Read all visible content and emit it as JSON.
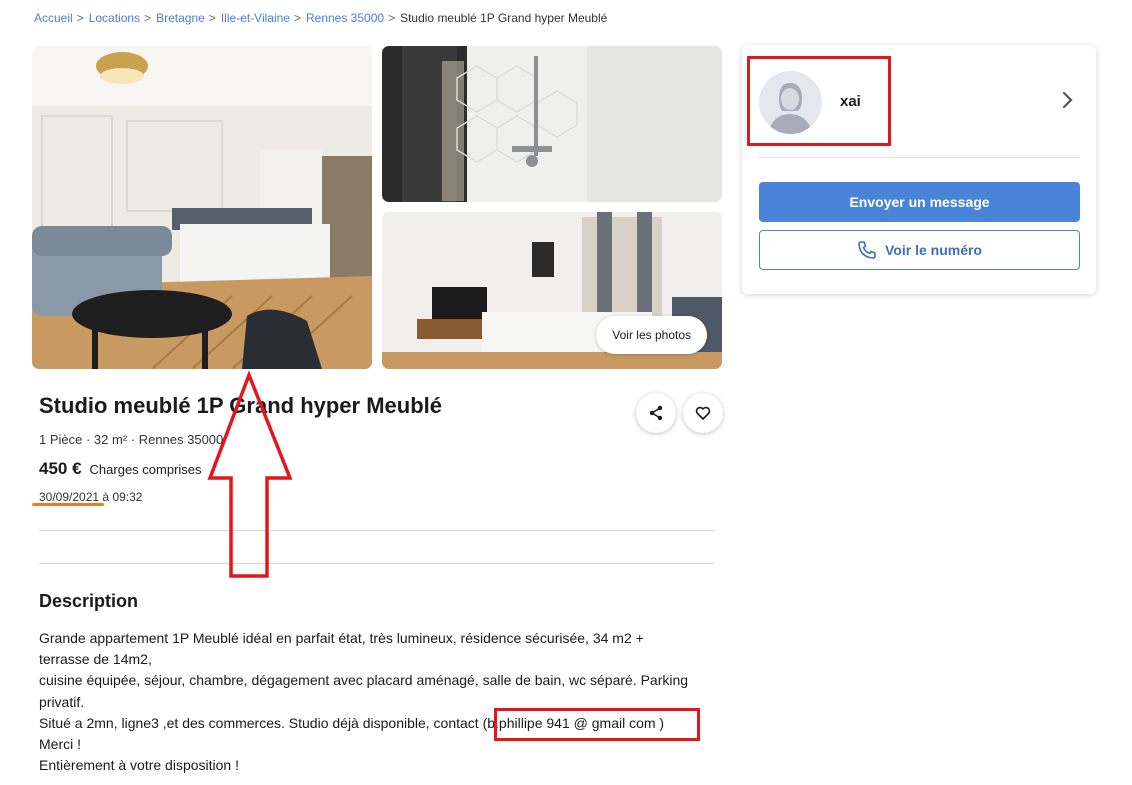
{
  "breadcrumb": {
    "items": [
      "Accueil",
      "Locations",
      "Bretagne",
      "Ille-et-Vilaine",
      "Rennes 35000"
    ],
    "separator": ">",
    "current": "Studio meublé 1P Grand hyper Meublé"
  },
  "gallery": {
    "see_photos_label": "Voir les photos"
  },
  "listing": {
    "title": "Studio meublé 1P Grand hyper Meublé",
    "subtitle": "1 Pièce · 32 m² · Rennes 35000",
    "price": "450 €",
    "charges": "Charges comprises",
    "date": "30/09/2021",
    "time_prefix": "à",
    "time": "09:32"
  },
  "description": {
    "heading": "Description",
    "lines": [
      "Grande appartement 1P Meublé idéal en parfait état, très lumineux, résidence sécurisée, 34 m2 +",
      "terrasse de 14m2,",
      "cuisine équipée, séjour, chambre, dégagement avec placard aménagé, salle de bain, wc séparé. Parking",
      "privatif.",
      "Situé a 2mn, ligne3 ,et des commerces. Studio déjà disponible, contact (b.phillipe 941 @ gmail com )",
      "Merci !",
      "Entièrement à votre disposition !"
    ]
  },
  "seller": {
    "name": "xai",
    "send_message_label": "Envoyer un message",
    "show_number_label": "Voir le numéro"
  },
  "colors": {
    "link": "#4a7fd4",
    "primary_button": "#4a84d8",
    "annotation_red": "#e0171d",
    "date_underline": "#f07a23"
  }
}
